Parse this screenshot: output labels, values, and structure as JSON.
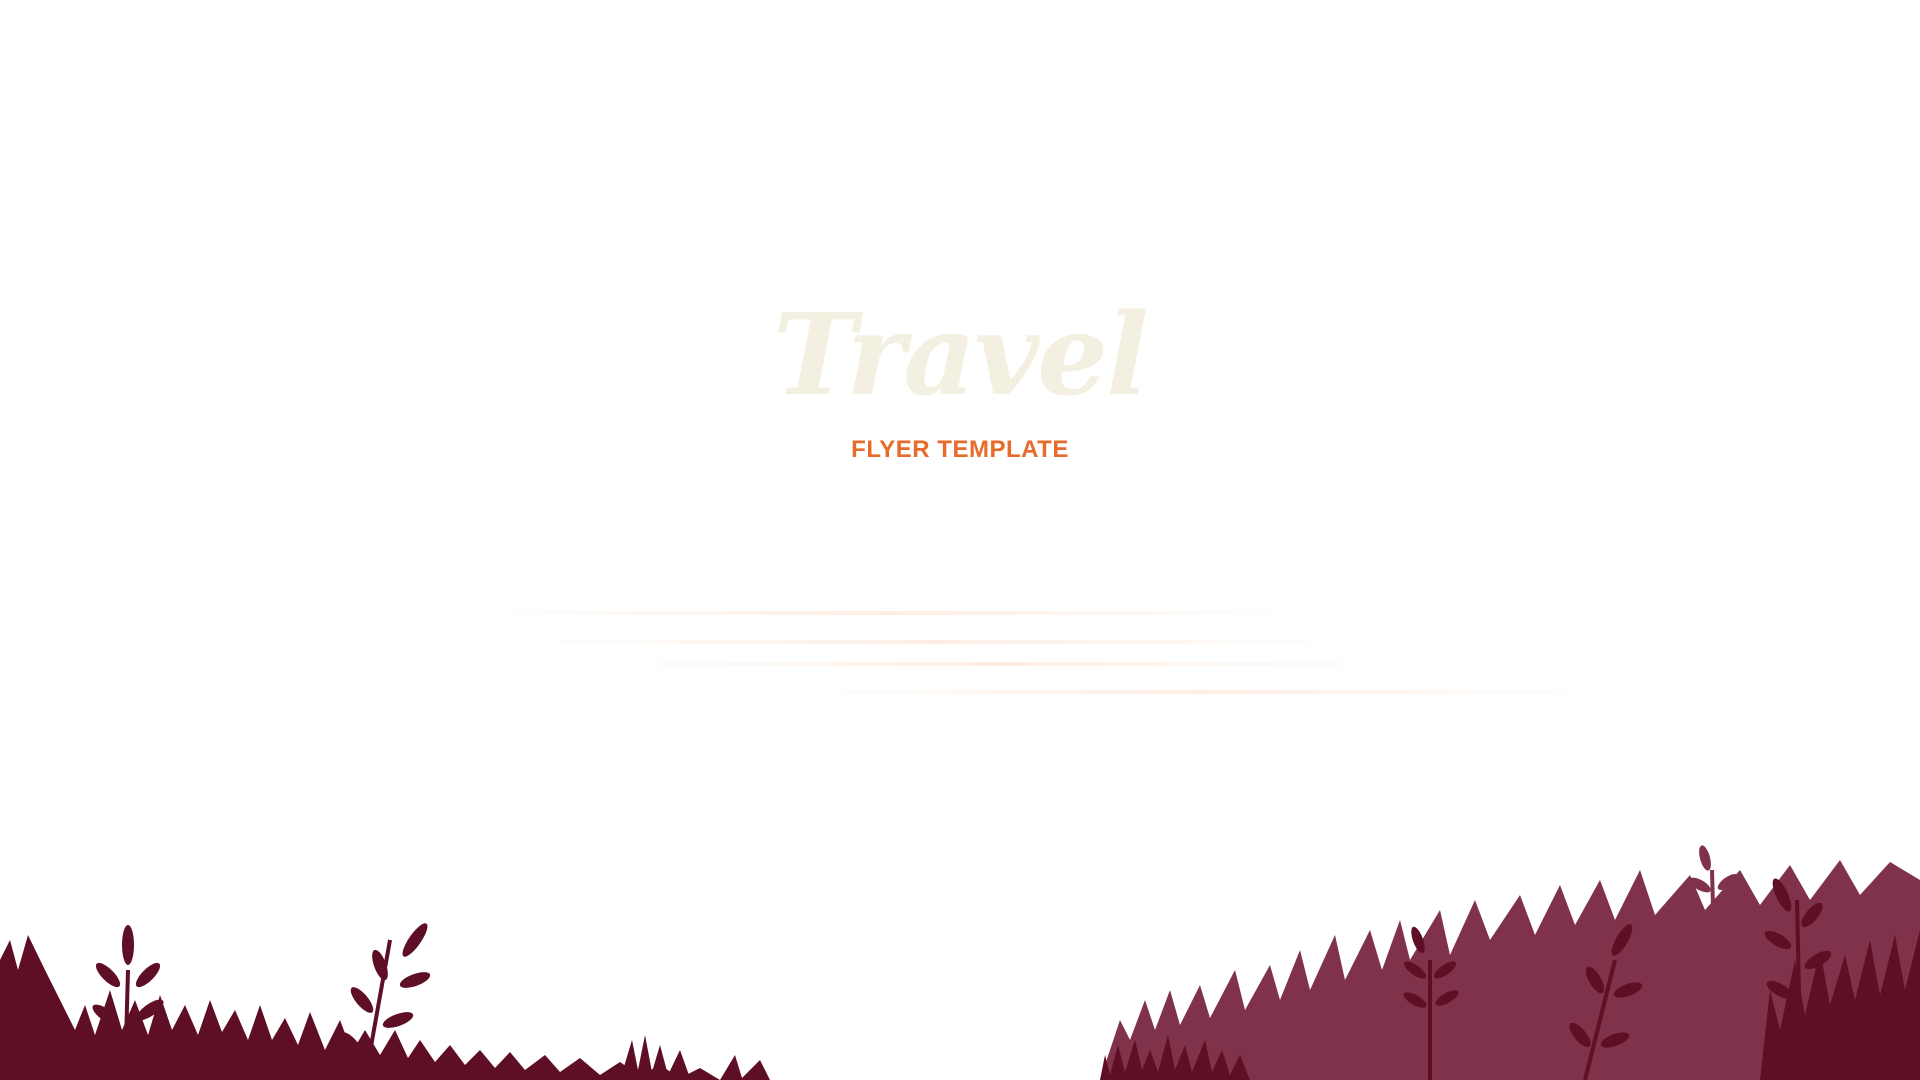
{
  "flyer": {
    "title": "Travel",
    "subtitle": "FLYER TEMPLATE"
  },
  "colors": {
    "title": "#f3f0e2",
    "subtitle": "#e76b2a",
    "grass_dark": "#5e0f25",
    "grass_light": "#80324a"
  },
  "illustration": {
    "ground": "grass-silhouette",
    "plants": "leafy-sprig-icon"
  }
}
